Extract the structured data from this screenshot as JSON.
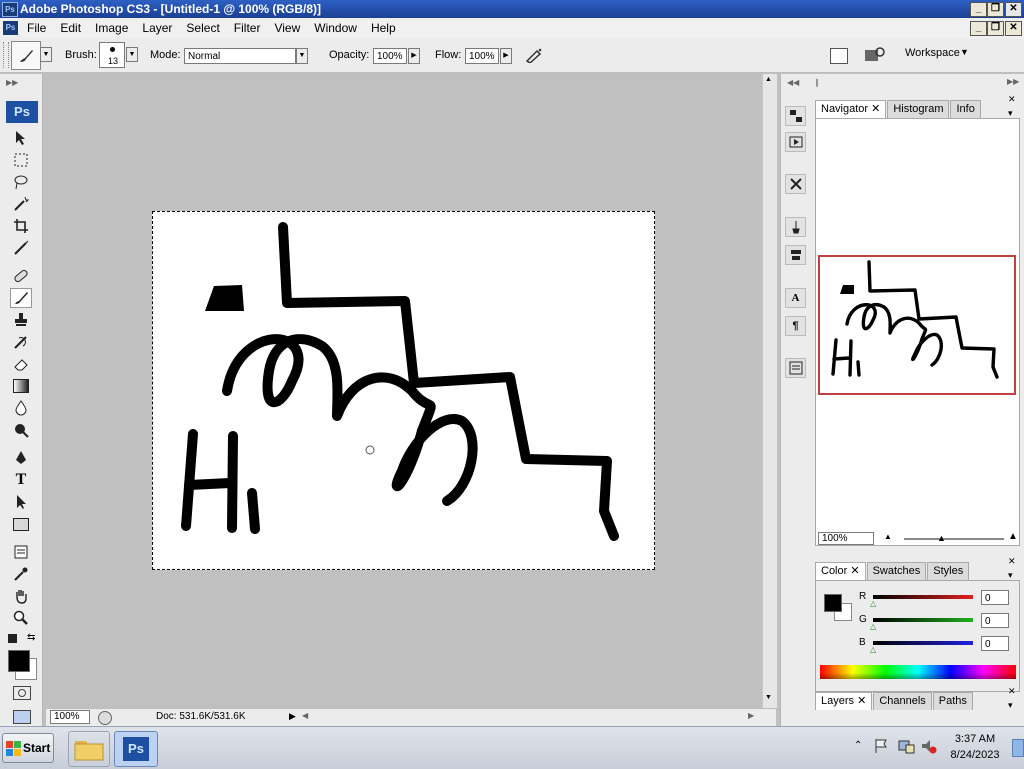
{
  "window": {
    "title": "Adobe Photoshop CS3 - [Untitled-1 @ 100% (RGB/8)]",
    "app_icon": "Ps",
    "minimize": "_",
    "restore": "❐",
    "close": "✕"
  },
  "menu": {
    "items": [
      "File",
      "Edit",
      "Image",
      "Layer",
      "Select",
      "Filter",
      "View",
      "Window",
      "Help"
    ]
  },
  "options": {
    "brush_label": "Brush:",
    "brush_size": "13",
    "mode_label": "Mode:",
    "mode_value": "Normal",
    "opacity_label": "Opacity:",
    "opacity_value": "100%",
    "flow_label": "Flow:",
    "flow_value": "100%",
    "workspace_label": "Workspace"
  },
  "toolbox": {
    "logo": "Ps",
    "type_tool_glyph": "T"
  },
  "document": {
    "handwriting": "Hi"
  },
  "status": {
    "zoom": "100%",
    "doc_info": "Doc: 531.6K/531.6K"
  },
  "panels": {
    "navigator": {
      "tabs": [
        "Navigator",
        "Histogram",
        "Info"
      ],
      "zoom": "100%",
      "thumb_text": "Hi"
    },
    "color": {
      "tabs": [
        "Color",
        "Swatches",
        "Styles"
      ],
      "channels": [
        {
          "label": "R",
          "value": "0",
          "color": "#e02020"
        },
        {
          "label": "G",
          "value": "0",
          "color": "#20b020"
        },
        {
          "label": "B",
          "value": "0",
          "color": "#2020e0"
        }
      ]
    },
    "layers": {
      "tabs": [
        "Layers",
        "Channels",
        "Paths"
      ]
    },
    "icon_glyphs": {
      "character": "A",
      "paragraph": "¶"
    }
  },
  "taskbar": {
    "start_label": "Start",
    "ps_label": "Ps",
    "time": "3:37 AM",
    "date": "8/24/2023"
  },
  "colors": {
    "foreground": "#000000",
    "background": "#ffffff",
    "workspace": "#c0c0c0",
    "navigator_frame": "#c04040"
  }
}
